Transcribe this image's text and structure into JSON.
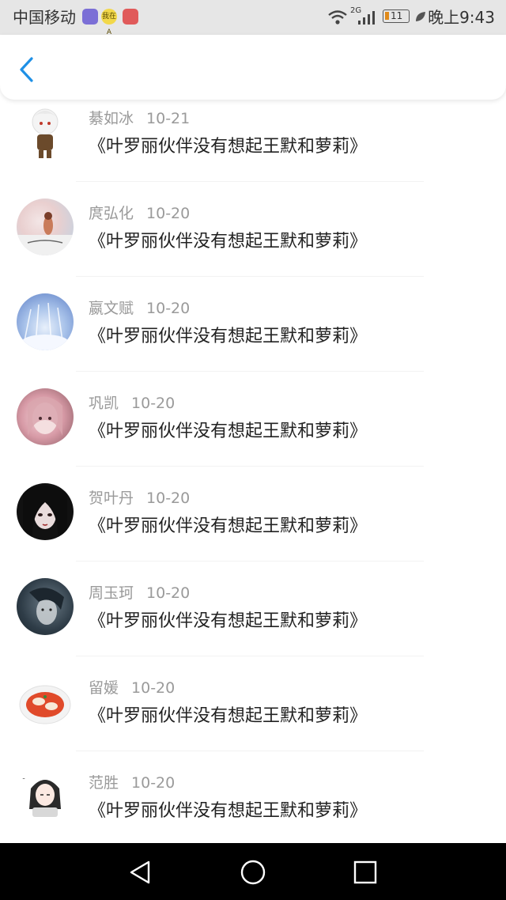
{
  "status_bar": {
    "carrier": "中国移动",
    "badge_1": "",
    "badge_2": "我在A",
    "network": "2G",
    "battery": "11",
    "time": "晚上9:43"
  },
  "nav_bar": {
    "back_icon": "chevron-left-icon"
  },
  "list": {
    "items": [
      {
        "name": "綦如冰",
        "date": "10-21",
        "title": "《叶罗丽伙伴没有想起王默和萝莉》"
      },
      {
        "name": "庹弘化",
        "date": "10-20",
        "title": "《叶罗丽伙伴没有想起王默和萝莉》"
      },
      {
        "name": "嬴文赋",
        "date": "10-20",
        "title": "《叶罗丽伙伴没有想起王默和萝莉》"
      },
      {
        "name": "巩凯",
        "date": "10-20",
        "title": "《叶罗丽伙伴没有想起王默和萝莉》"
      },
      {
        "name": "贺叶丹",
        "date": "10-20",
        "title": "《叶罗丽伙伴没有想起王默和萝莉》"
      },
      {
        "name": "周玉珂",
        "date": "10-20",
        "title": "《叶罗丽伙伴没有想起王默和萝莉》"
      },
      {
        "name": "留媛",
        "date": "10-20",
        "title": "《叶罗丽伙伴没有想起王默和萝莉》"
      },
      {
        "name": "范胜",
        "date": "10-20",
        "title": "《叶罗丽伙伴没有想起王默和萝莉》"
      }
    ]
  },
  "colors": {
    "accent": "#1e90e6",
    "status_bar": "#e6e6e6",
    "name_text": "#9a9a9a",
    "title_text": "#222222"
  },
  "system_nav": {
    "back": "triangle-back-icon",
    "home": "circle-home-icon",
    "recents": "square-recents-icon"
  }
}
